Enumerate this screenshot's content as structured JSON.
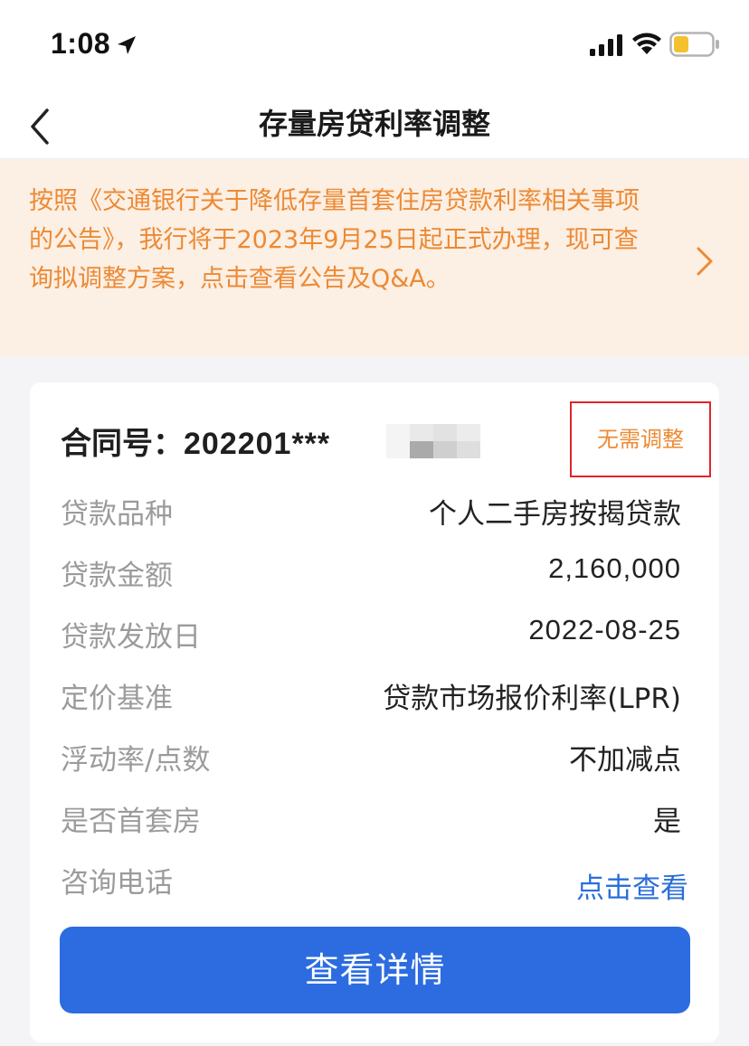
{
  "status_bar": {
    "time": "1:08"
  },
  "nav": {
    "title": "存量房贷利率调整"
  },
  "notice": {
    "text": "按照《交通银行关于降低存量首套住房贷款利率相关事项的公告》，我行将于2023年9月25日起正式办理，现可查询拟调整方案，点击查看公告及Q&A。"
  },
  "card": {
    "contract_label": "合同号：",
    "contract_value": "202201***",
    "status_tag": "无需调整",
    "rows": [
      {
        "label": "贷款品种",
        "value": "个人二手房按揭贷款"
      },
      {
        "label": "贷款金额",
        "value": "2,160,000"
      },
      {
        "label": "贷款发放日",
        "value": "2022-08-25"
      },
      {
        "label": "定价基准",
        "value": "贷款市场报价利率(LPR)"
      },
      {
        "label": "浮动率/点数",
        "value": "不加减点"
      },
      {
        "label": "是否首套房",
        "value": "是"
      },
      {
        "label": "咨询电话",
        "value": "点击查看"
      }
    ],
    "detail_button": "查看详情"
  },
  "colors": {
    "accent_blue": "#2c6ce0",
    "notice_orange": "#ec8a34",
    "notice_bg": "#fcefe4",
    "highlight_red": "#e0252a",
    "link_blue": "#2a6fd8"
  }
}
